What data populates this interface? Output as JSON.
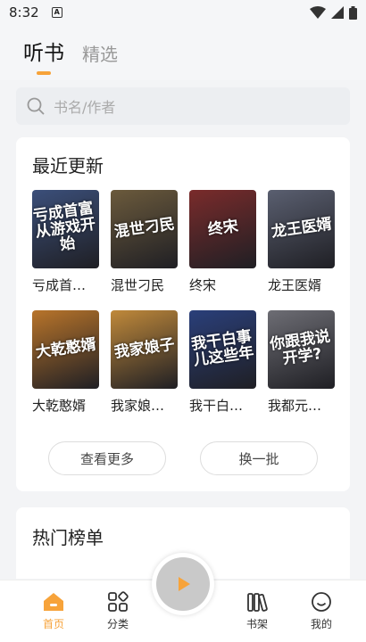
{
  "status": {
    "time": "8:32",
    "notif": "A"
  },
  "tabs": [
    {
      "label": "听书",
      "active": true
    },
    {
      "label": "精选",
      "active": false
    }
  ],
  "search": {
    "placeholder": "书名/作者"
  },
  "recent": {
    "title": "最近更新",
    "books": [
      {
        "title": "亏成首…",
        "cover_text": "亏成首富从游戏开始",
        "bg": "#3b4f7a"
      },
      {
        "title": "混世刁民",
        "cover_text": "混世刁民",
        "bg": "#6b5a3c"
      },
      {
        "title": "终宋",
        "cover_text": "终宋",
        "bg": "#7a2b2b"
      },
      {
        "title": "龙王医婿",
        "cover_text": "龙王医婿",
        "bg": "#5a5f70"
      },
      {
        "title": "大乾憨婿",
        "cover_text": "大乾憨婿",
        "bg": "#b8742a"
      },
      {
        "title": "我家娘…",
        "cover_text": "我家娘子",
        "bg": "#c0893a"
      },
      {
        "title": "我干白…",
        "cover_text": "我干白事儿这些年",
        "bg": "#2a3f7a"
      },
      {
        "title": "我都元…",
        "cover_text": "你跟我说开学?",
        "bg": "#6d6d74"
      }
    ],
    "more_label": "查看更多",
    "refresh_label": "换一批"
  },
  "hot": {
    "title": "热门榜单"
  },
  "nav": [
    {
      "label": "首页",
      "icon": "home-icon",
      "active": true
    },
    {
      "label": "分类",
      "icon": "category-icon",
      "active": false
    },
    {
      "label": "书架",
      "icon": "bookshelf-icon",
      "active": false
    },
    {
      "label": "我的",
      "icon": "profile-icon",
      "active": false
    }
  ],
  "colors": {
    "accent": "#f7a33a"
  }
}
